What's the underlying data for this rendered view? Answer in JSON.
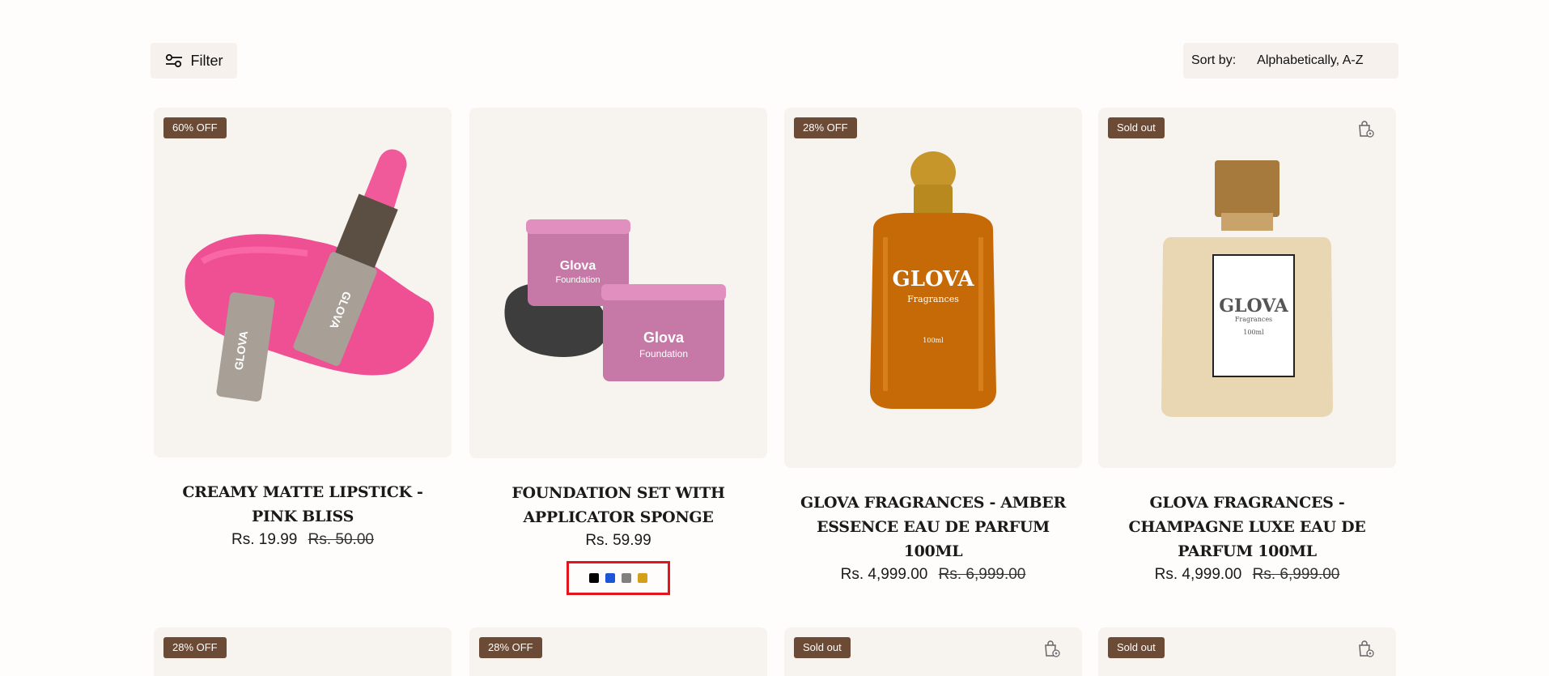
{
  "toolbar": {
    "filter_label": "Filter",
    "sort_label": "Sort by:",
    "sort_value": "Alphabetically, A-Z"
  },
  "products": [
    {
      "badge": "60% OFF",
      "title": "CREAMY MATTE LIPSTICK - PINK BLISS",
      "price": "Rs. 19.99",
      "compare": "Rs. 50.00",
      "sold_out": false
    },
    {
      "badge": "",
      "title": "FOUNDATION SET WITH APPLICATOR SPONGE",
      "price": "Rs. 59.99",
      "compare": "",
      "sold_out": false,
      "swatches": [
        "#000000",
        "#1a56d6",
        "#808080",
        "#d4a017"
      ]
    },
    {
      "badge": "28% OFF",
      "title": "GLOVA FRAGRANCES - AMBER ESSENCE EAU DE PARFUM 100ML",
      "price": "Rs. 4,999.00",
      "compare": "Rs. 6,999.00",
      "sold_out": false
    },
    {
      "badge": "Sold out",
      "title": "GLOVA FRAGRANCES - CHAMPAGNE LUXE EAU DE PARFUM 100ML",
      "price": "Rs. 4,999.00",
      "compare": "Rs. 6,999.00",
      "sold_out": true
    }
  ],
  "product_images": {
    "lipstick_brand": "GLOVA",
    "foundation_brand": "Glova",
    "foundation_sub": "Foundation",
    "perfume_brand": "GLOVA",
    "perfume_sub": "Fragrances",
    "perfume_size": "100ml"
  },
  "row2_badges": [
    "28% OFF",
    "28% OFF",
    "Sold out",
    "Sold out"
  ],
  "colors": {
    "badge_bg": "#6b4a36",
    "card_bg": "#f7f3ef",
    "toolbar_bg": "#f6f1ec",
    "highlight": "#e3141c"
  }
}
